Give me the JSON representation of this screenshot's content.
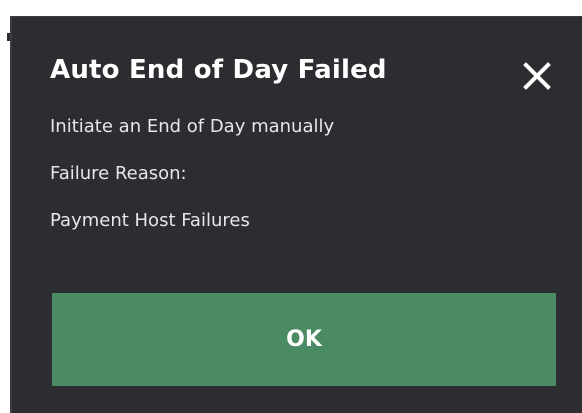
{
  "dialog": {
    "title": "Auto End of Day Failed",
    "message": "Initiate an End of Day manually",
    "failure_label": "Failure Reason:",
    "failure_reason": "Payment Host Failures",
    "ok_label": "OK",
    "close_icon": "close-icon",
    "colors": {
      "background": "#2b2d31",
      "title_text": "#ffffff",
      "body_text": "#e6e7e9",
      "ok_button": "#4a8b64"
    }
  }
}
